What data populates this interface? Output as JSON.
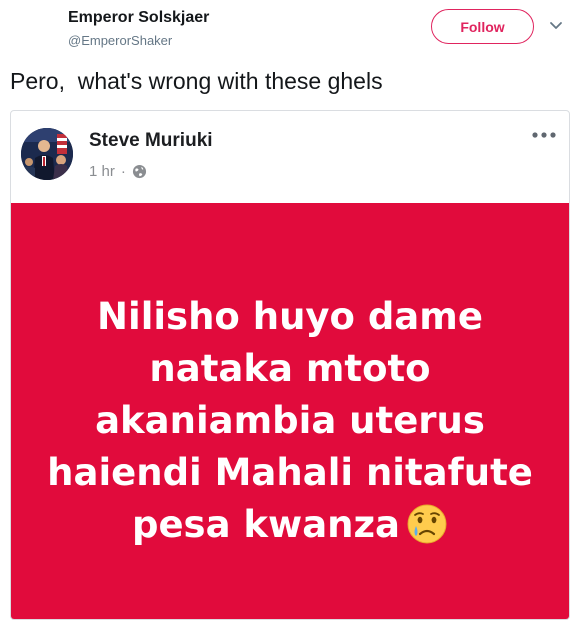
{
  "tweet": {
    "author_name": "Emperor Solskjaer",
    "author_handle": "@EmperorShaker",
    "follow_label": "Follow",
    "text": "Pero,  what's wrong with these ghels"
  },
  "embedded_post": {
    "author_name": "Steve Muriuki",
    "timestamp": "1 hr",
    "separator": "·",
    "privacy_icon": "globe-icon",
    "background_color": "#e10b3c",
    "text_lines": [
      "Nilisho huyo dame",
      "nataka mtoto",
      "akaniambia uterus",
      "haiendi Mahali nitafute",
      "pesa kwanza"
    ],
    "emoji": "crying-face-emoji"
  },
  "colors": {
    "follow_accent": "#e0245e",
    "text_primary": "#14171a",
    "text_secondary": "#657786"
  }
}
